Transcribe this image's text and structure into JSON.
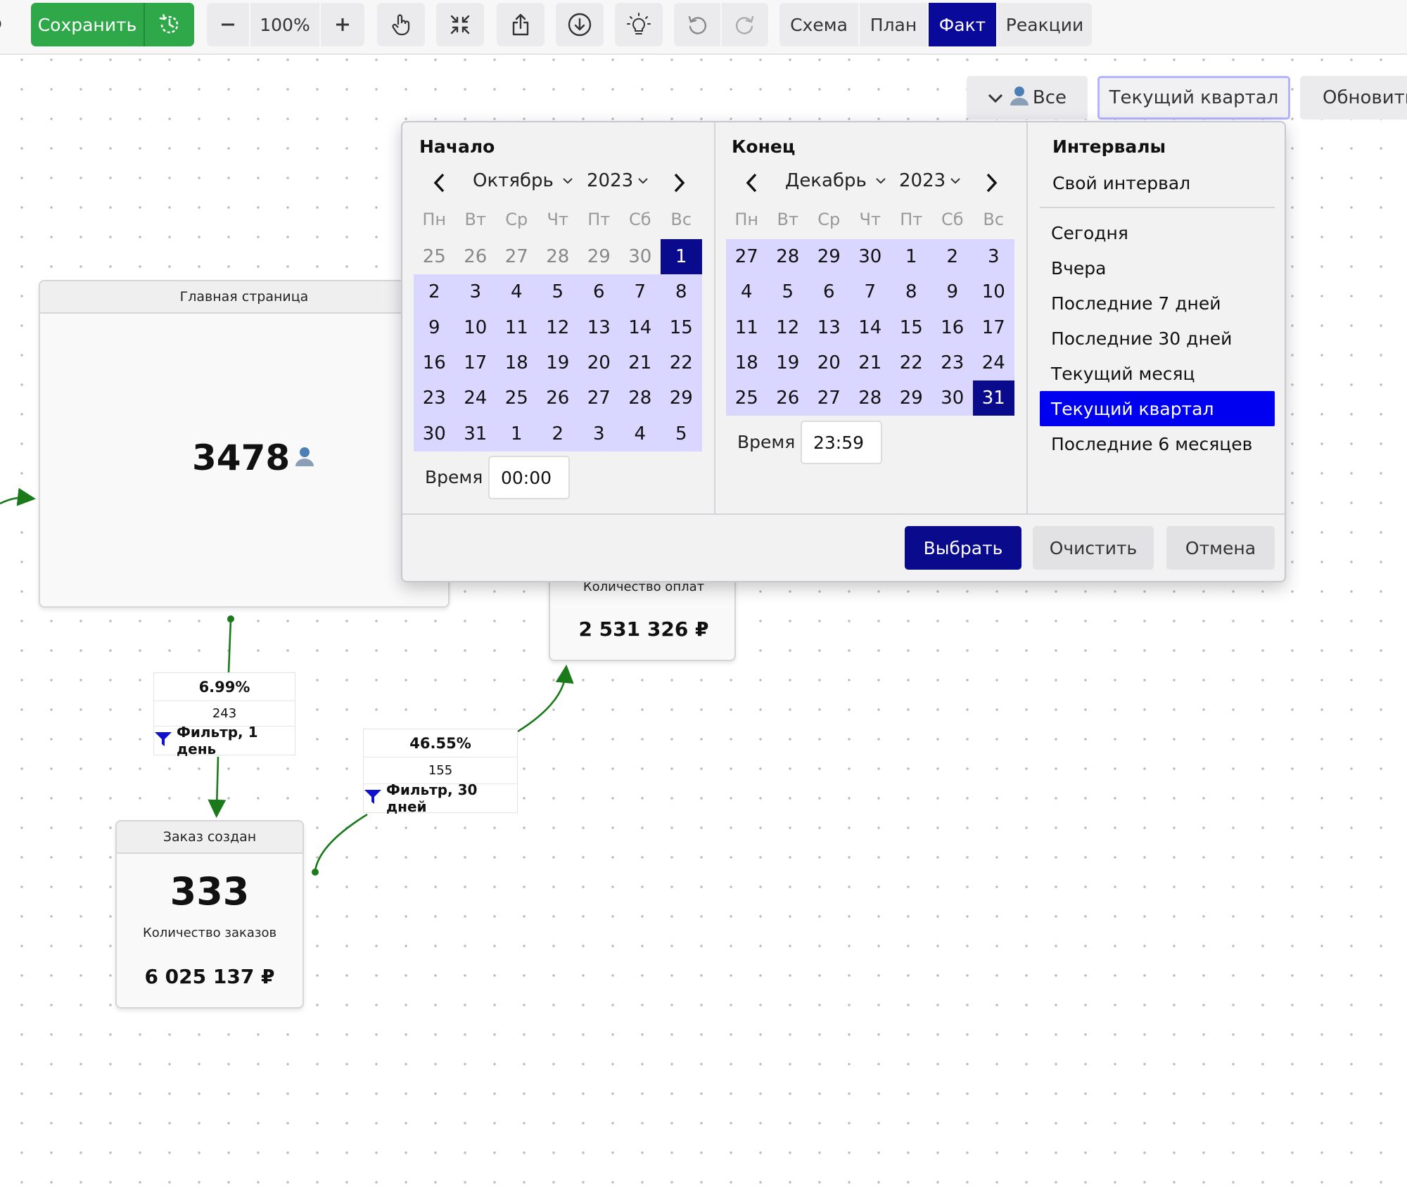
{
  "toolbar": {
    "save_label": "Сохранить",
    "zoom": "100%",
    "tabs": [
      {
        "label": "Схема",
        "active": false
      },
      {
        "label": "План",
        "active": false
      },
      {
        "label": "Факт",
        "active": true
      },
      {
        "label": "Реакции",
        "active": false
      }
    ],
    "icons": [
      "settings-icon",
      "history-icon",
      "minus-icon",
      "plus-icon",
      "hand-pointer-icon",
      "collapse-icon",
      "share-icon",
      "download-icon",
      "lightbulb-icon",
      "undo-icon",
      "redo-icon"
    ]
  },
  "filters": {
    "segment_label": "Все",
    "period_label": "Текущий квартал",
    "refresh_label": "Обновить"
  },
  "nodes": {
    "main": {
      "title": "Главная страница",
      "count": "3478"
    },
    "order": {
      "title": "Заказ создан",
      "count": "333",
      "metric_label": "Количество заказов",
      "sum": "6 025 137 ₽"
    },
    "payment": {
      "metric_label": "Количество оплат",
      "sum": "2 531 326 ₽"
    }
  },
  "edges": {
    "main_to_order": {
      "percent": "6.99%",
      "count": "243",
      "filter": "Фильтр, 1 день"
    },
    "order_to_payment": {
      "percent": "46.55%",
      "count": "155",
      "filter": "Фильтр, 30 дней"
    }
  },
  "date_picker": {
    "weekdays": [
      "Пн",
      "Вт",
      "Ср",
      "Чт",
      "Пт",
      "Сб",
      "Вс"
    ],
    "start": {
      "title": "Начало",
      "month": "Октябрь",
      "year": "2023",
      "time_label": "Время",
      "time": "00:00",
      "days": [
        {
          "d": "25",
          "s": "muted"
        },
        {
          "d": "26",
          "s": "muted"
        },
        {
          "d": "27",
          "s": "muted"
        },
        {
          "d": "28",
          "s": "muted"
        },
        {
          "d": "29",
          "s": "muted"
        },
        {
          "d": "30",
          "s": "muted"
        },
        {
          "d": "1",
          "s": "sel"
        },
        {
          "d": "2",
          "s": "range"
        },
        {
          "d": "3",
          "s": "range"
        },
        {
          "d": "4",
          "s": "range"
        },
        {
          "d": "5",
          "s": "range"
        },
        {
          "d": "6",
          "s": "range"
        },
        {
          "d": "7",
          "s": "range"
        },
        {
          "d": "8",
          "s": "range"
        },
        {
          "d": "9",
          "s": "range"
        },
        {
          "d": "10",
          "s": "range"
        },
        {
          "d": "11",
          "s": "range"
        },
        {
          "d": "12",
          "s": "range"
        },
        {
          "d": "13",
          "s": "range"
        },
        {
          "d": "14",
          "s": "range"
        },
        {
          "d": "15",
          "s": "range"
        },
        {
          "d": "16",
          "s": "range"
        },
        {
          "d": "17",
          "s": "range"
        },
        {
          "d": "18",
          "s": "range"
        },
        {
          "d": "19",
          "s": "range"
        },
        {
          "d": "20",
          "s": "range"
        },
        {
          "d": "21",
          "s": "range"
        },
        {
          "d": "22",
          "s": "range"
        },
        {
          "d": "23",
          "s": "range"
        },
        {
          "d": "24",
          "s": "range"
        },
        {
          "d": "25",
          "s": "range"
        },
        {
          "d": "26",
          "s": "range"
        },
        {
          "d": "27",
          "s": "range"
        },
        {
          "d": "28",
          "s": "range"
        },
        {
          "d": "29",
          "s": "range"
        },
        {
          "d": "30",
          "s": "range"
        },
        {
          "d": "31",
          "s": "range"
        },
        {
          "d": "1",
          "s": "range"
        },
        {
          "d": "2",
          "s": "range"
        },
        {
          "d": "3",
          "s": "range"
        },
        {
          "d": "4",
          "s": "range"
        },
        {
          "d": "5",
          "s": "range"
        }
      ]
    },
    "end": {
      "title": "Конец",
      "month": "Декабрь",
      "year": "2023",
      "time_label": "Время",
      "time": "23:59",
      "days": [
        {
          "d": "27",
          "s": "range"
        },
        {
          "d": "28",
          "s": "range"
        },
        {
          "d": "29",
          "s": "range"
        },
        {
          "d": "30",
          "s": "range"
        },
        {
          "d": "1",
          "s": "range"
        },
        {
          "d": "2",
          "s": "range"
        },
        {
          "d": "3",
          "s": "range"
        },
        {
          "d": "4",
          "s": "range"
        },
        {
          "d": "5",
          "s": "range"
        },
        {
          "d": "6",
          "s": "range"
        },
        {
          "d": "7",
          "s": "range"
        },
        {
          "d": "8",
          "s": "range"
        },
        {
          "d": "9",
          "s": "range"
        },
        {
          "d": "10",
          "s": "range"
        },
        {
          "d": "11",
          "s": "range"
        },
        {
          "d": "12",
          "s": "range"
        },
        {
          "d": "13",
          "s": "range"
        },
        {
          "d": "14",
          "s": "range"
        },
        {
          "d": "15",
          "s": "range"
        },
        {
          "d": "16",
          "s": "range"
        },
        {
          "d": "17",
          "s": "range"
        },
        {
          "d": "18",
          "s": "range"
        },
        {
          "d": "19",
          "s": "range"
        },
        {
          "d": "20",
          "s": "range"
        },
        {
          "d": "21",
          "s": "range"
        },
        {
          "d": "22",
          "s": "range"
        },
        {
          "d": "23",
          "s": "range"
        },
        {
          "d": "24",
          "s": "range"
        },
        {
          "d": "25",
          "s": "range"
        },
        {
          "d": "26",
          "s": "range"
        },
        {
          "d": "27",
          "s": "range"
        },
        {
          "d": "28",
          "s": "range"
        },
        {
          "d": "29",
          "s": "range"
        },
        {
          "d": "30",
          "s": "range"
        },
        {
          "d": "31",
          "s": "sel"
        }
      ]
    },
    "intervals": {
      "title": "Интервалы",
      "custom": "Свой интервал",
      "items": [
        {
          "label": "Сегодня",
          "active": false
        },
        {
          "label": "Вчера",
          "active": false
        },
        {
          "label": "Последние 7 дней",
          "active": false
        },
        {
          "label": "Последние 30 дней",
          "active": false
        },
        {
          "label": "Текущий месяц",
          "active": false
        },
        {
          "label": "Текущий квартал",
          "active": true
        },
        {
          "label": "Последние 6 месяцев",
          "active": false
        }
      ]
    },
    "buttons": {
      "apply": "Выбрать",
      "clear": "Очистить",
      "cancel": "Отмена"
    }
  },
  "colors": {
    "save_green": "#2fa84a",
    "accent_navy": "#0a0a8c",
    "range_lavender": "#d9d6ff",
    "interval_active": "#0000f0",
    "edge_green": "#1a7a1a",
    "filter_blue": "#1010d0"
  }
}
